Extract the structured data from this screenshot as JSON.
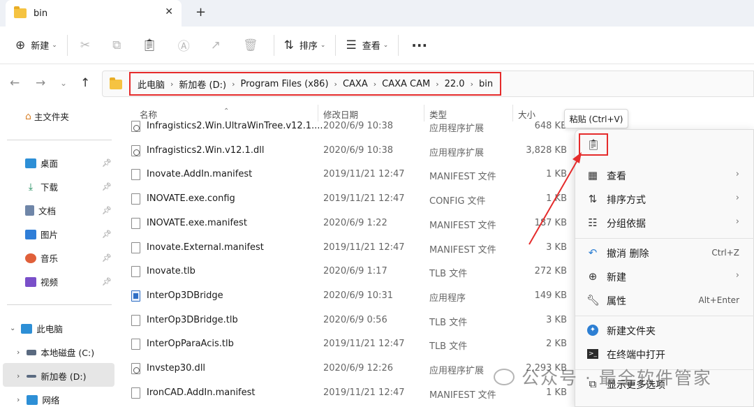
{
  "tab": {
    "title": "bin"
  },
  "toolbar": {
    "new_label": "新建",
    "sort_label": "排序",
    "view_label": "查看",
    "more": "···"
  },
  "address": {
    "crumbs": [
      "此电脑",
      "新加卷 (D:)",
      "Program Files (x86)",
      "CAXA",
      "CAXA CAM",
      "22.0",
      "bin"
    ]
  },
  "sidebar": {
    "home": "主文件夹",
    "quick": [
      {
        "label": "桌面"
      },
      {
        "label": "下载"
      },
      {
        "label": "文档"
      },
      {
        "label": "图片"
      },
      {
        "label": "音乐"
      },
      {
        "label": "视频"
      }
    ],
    "this_pc": "此电脑",
    "drive_c": "本地磁盘 (C:)",
    "drive_d": "新加卷 (D:)",
    "network": "网络"
  },
  "columns": {
    "name": "名称",
    "date": "修改日期",
    "type": "类型",
    "size": "大小"
  },
  "files": [
    {
      "name": "Infragistics2.Win.UltraWinTree.v12.1....",
      "date": "2020/6/9 10:38",
      "type": "应用程序扩展",
      "size": "648 KB",
      "icon": "dll"
    },
    {
      "name": "Infragistics2.Win.v12.1.dll",
      "date": "2020/6/9 10:38",
      "type": "应用程序扩展",
      "size": "3,828 KB",
      "icon": "dll"
    },
    {
      "name": "Inovate.AddIn.manifest",
      "date": "2019/11/21 12:47",
      "type": "MANIFEST 文件",
      "size": "1 KB",
      "icon": "file"
    },
    {
      "name": "INOVATE.exe.config",
      "date": "2019/11/21 12:47",
      "type": "CONFIG 文件",
      "size": "1 KB",
      "icon": "file"
    },
    {
      "name": "INOVATE.exe.manifest",
      "date": "2020/6/9 1:22",
      "type": "MANIFEST 文件",
      "size": "187 KB",
      "icon": "file"
    },
    {
      "name": "Inovate.External.manifest",
      "date": "2019/11/21 12:47",
      "type": "MANIFEST 文件",
      "size": "3 KB",
      "icon": "file"
    },
    {
      "name": "Inovate.tlb",
      "date": "2020/6/9 1:17",
      "type": "TLB 文件",
      "size": "272 KB",
      "icon": "file"
    },
    {
      "name": "InterOp3DBridge",
      "date": "2020/6/9 10:31",
      "type": "应用程序",
      "size": "149 KB",
      "icon": "exe"
    },
    {
      "name": "InterOp3DBridge.tlb",
      "date": "2020/6/9 0:56",
      "type": "TLB 文件",
      "size": "3 KB",
      "icon": "file"
    },
    {
      "name": "InterOpParaAcis.tlb",
      "date": "2019/11/21 12:47",
      "type": "TLB 文件",
      "size": "2 KB",
      "icon": "file"
    },
    {
      "name": "Invstep30.dll",
      "date": "2020/6/9 12:26",
      "type": "应用程序扩展",
      "size": "2,293 KB",
      "icon": "dll"
    },
    {
      "name": "IronCAD.AddIn.manifest",
      "date": "2019/11/21 12:47",
      "type": "MANIFEST 文件",
      "size": "1 KB",
      "icon": "file"
    }
  ],
  "tooltip": "粘贴 (Ctrl+V)",
  "context_menu": {
    "view": "查看",
    "sort": "排序方式",
    "group": "分组依据",
    "undo": "撤消 删除",
    "undo_shortcut": "Ctrl+Z",
    "new": "新建",
    "properties": "属性",
    "properties_shortcut": "Alt+Enter",
    "new_folder": "新建文件夹",
    "terminal": "在终端中打开",
    "more_options": "显示更多选项"
  },
  "watermark": "公众号 · 最全软件管家",
  "colors": {
    "highlight_red": "#e52b2b",
    "folder_yellow": "#f5c341"
  }
}
